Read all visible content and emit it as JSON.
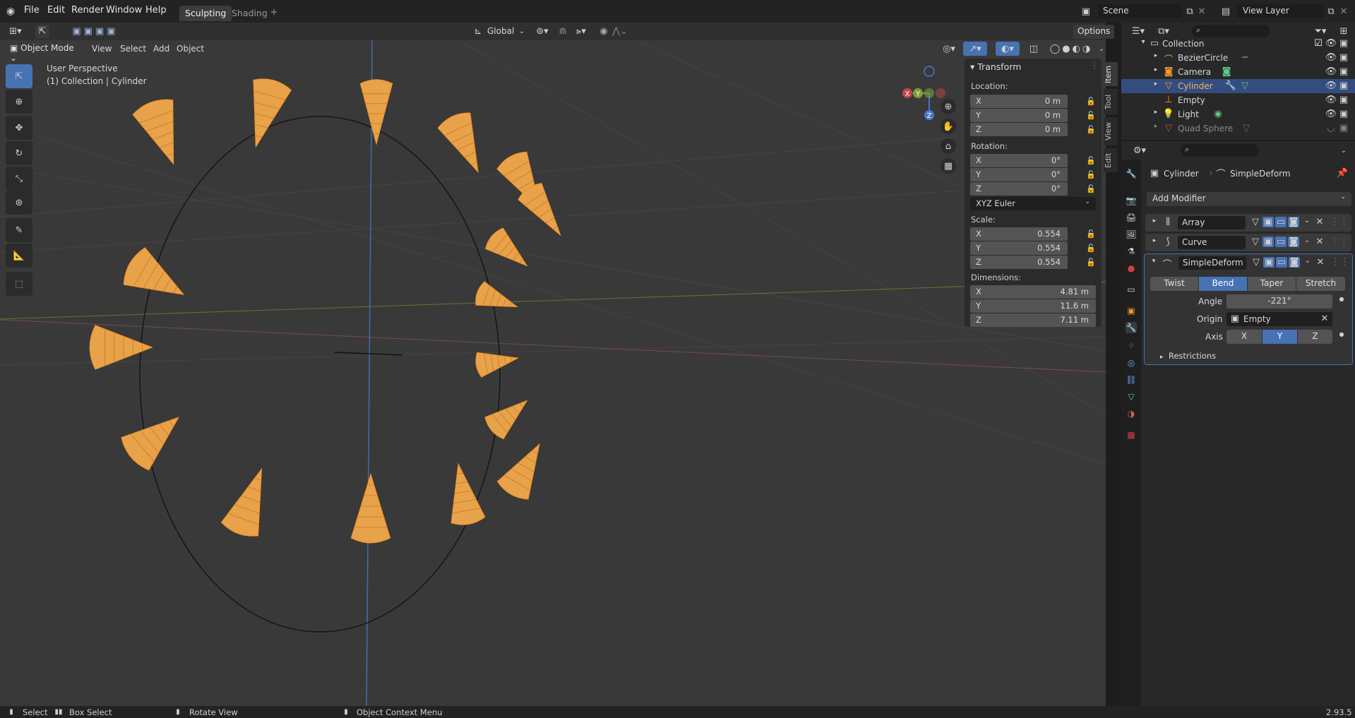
{
  "menu": {
    "file": "File",
    "edit": "Edit",
    "render": "Render",
    "window": "Window",
    "help": "Help"
  },
  "workspace_tabs": [
    {
      "label": "Sculpting"
    },
    {
      "label": "Shading"
    }
  ],
  "scene": {
    "name": "Scene",
    "view_layer": "View Layer"
  },
  "viewport_header": {
    "transform": "Global",
    "options": "Options"
  },
  "mode_bar": {
    "mode": "Object Mode",
    "view": "View",
    "select": "Select",
    "add": "Add",
    "object": "Object"
  },
  "overlay": {
    "perspective": "User Perspective",
    "context": "(1) Collection | Cylinder"
  },
  "gizmo": {
    "x": "X",
    "y": "Y",
    "z": "Z"
  },
  "npanel": {
    "section": "Transform",
    "location_label": "Location:",
    "location": [
      {
        "axis": "X",
        "value": "0 m"
      },
      {
        "axis": "Y",
        "value": "0 m"
      },
      {
        "axis": "Z",
        "value": "0 m"
      }
    ],
    "rotation_label": "Rotation:",
    "rotation": [
      {
        "axis": "X",
        "value": "0°"
      },
      {
        "axis": "Y",
        "value": "0°"
      },
      {
        "axis": "Z",
        "value": "0°"
      }
    ],
    "rotation_mode": "XYZ Euler",
    "scale_label": "Scale:",
    "scale": [
      {
        "axis": "X",
        "value": "0.554"
      },
      {
        "axis": "Y",
        "value": "0.554"
      },
      {
        "axis": "Z",
        "value": "0.554"
      }
    ],
    "dimensions_label": "Dimensions:",
    "dimensions": [
      {
        "axis": "X",
        "value": "4.81 m"
      },
      {
        "axis": "Y",
        "value": "11.6 m"
      },
      {
        "axis": "Z",
        "value": "7.11 m"
      }
    ],
    "tabs": [
      "Item",
      "Tool",
      "View",
      "Edit"
    ]
  },
  "outliner": {
    "collection": "Collection",
    "items": [
      {
        "name": "BezierCircle"
      },
      {
        "name": "Camera"
      },
      {
        "name": "Cylinder"
      },
      {
        "name": "Empty"
      },
      {
        "name": "Light"
      },
      {
        "name": "Quad Sphere"
      }
    ]
  },
  "properties": {
    "object": "Cylinder",
    "modifier": "SimpleDeform",
    "add_modifier": "Add Modifier",
    "modifiers": [
      {
        "name": "Array"
      },
      {
        "name": "Curve"
      },
      {
        "name": "SimpleDeform"
      }
    ],
    "deform_modes": [
      "Twist",
      "Bend",
      "Taper",
      "Stretch"
    ],
    "angle_label": "Angle",
    "angle": "-221°",
    "origin_label": "Origin",
    "origin": "Empty",
    "axis_label": "Axis",
    "axes": [
      "X",
      "Y",
      "Z"
    ],
    "restrictions": "Restrictions"
  },
  "status": {
    "select": "Select",
    "box_select": "Box Select",
    "rotate": "Rotate View",
    "context": "Object Context Menu",
    "version": "2.93.5"
  },
  "colors": {
    "accent": "#4772b3",
    "selected_orange": "#f5952a",
    "bg_viewport": "#393939"
  }
}
